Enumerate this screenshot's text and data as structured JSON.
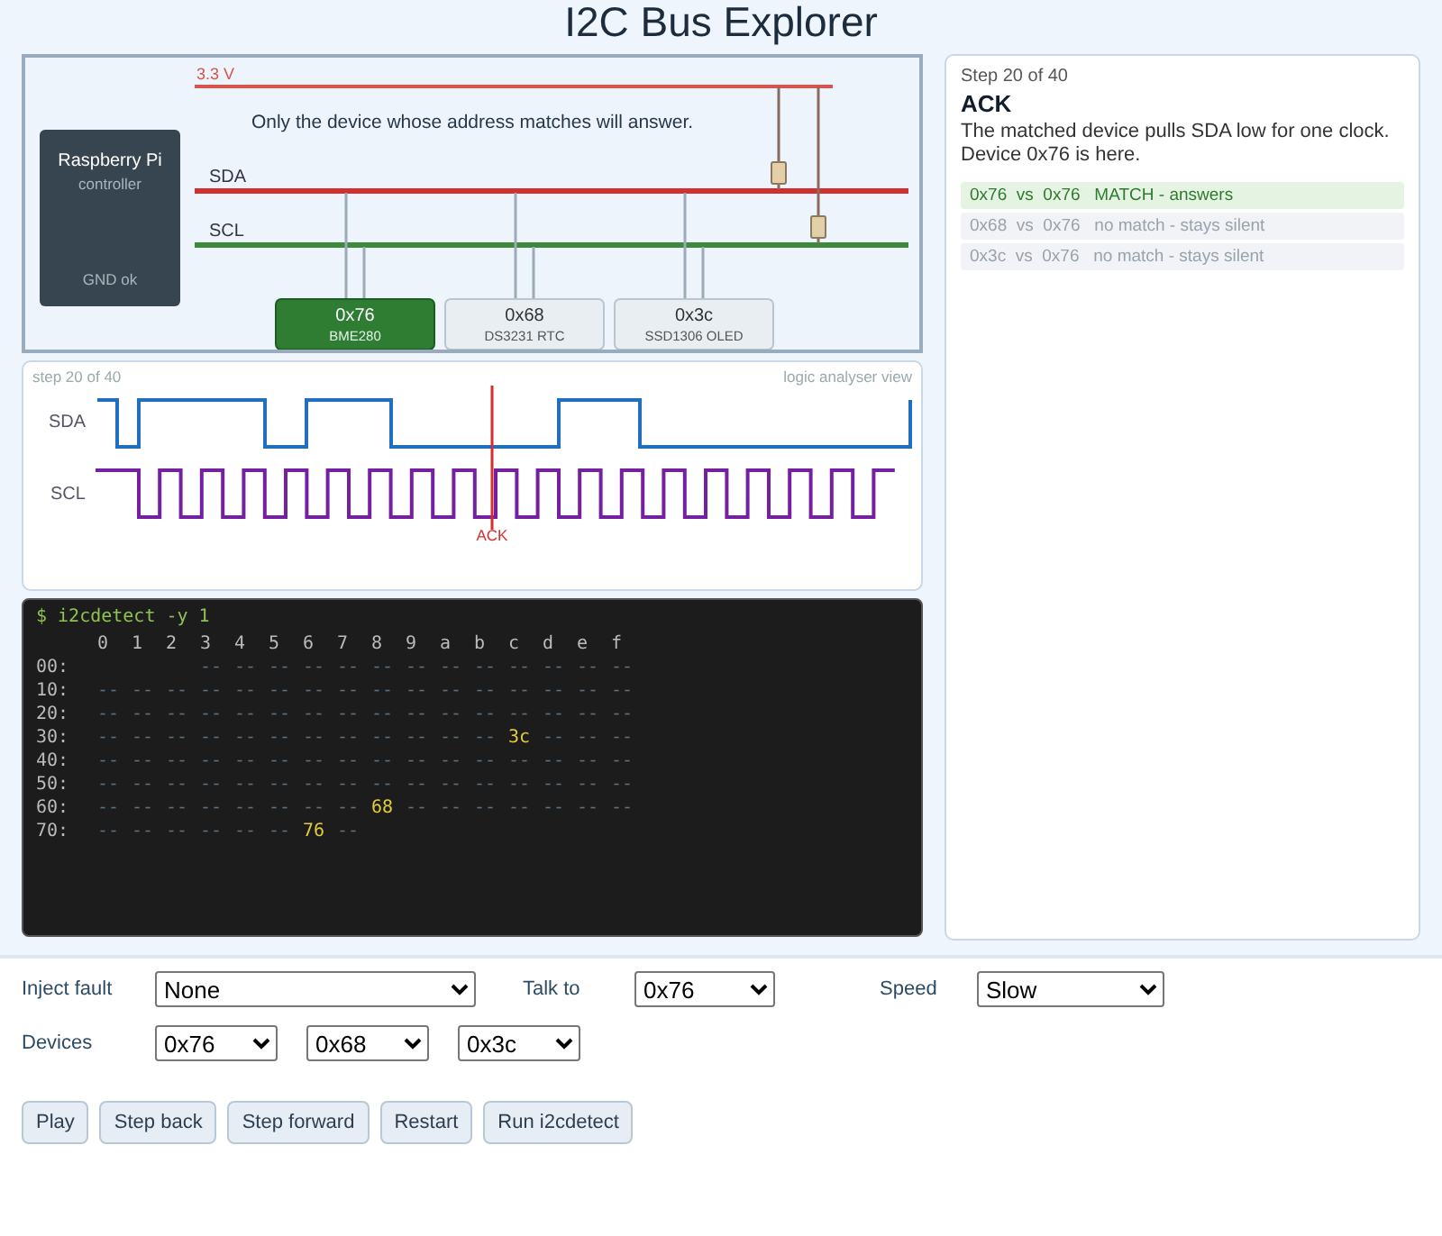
{
  "title": "I2C Bus Explorer",
  "bus": {
    "voltage": "3.3 V",
    "caption": "Only the device whose address matches will answer.",
    "sda": "SDA",
    "scl": "SCL",
    "controller": {
      "name": "Raspberry Pi",
      "role": "controller",
      "status": "GND ok"
    },
    "devices": [
      {
        "address": "0x76",
        "name": "BME280",
        "selected": true
      },
      {
        "address": "0x68",
        "name": "DS3231 RTC",
        "selected": false
      },
      {
        "address": "0x3c",
        "name": "SSD1306 OLED",
        "selected": false
      }
    ]
  },
  "analyser": {
    "step": "step 20 of 40",
    "view": "logic analyser view",
    "sda": "SDA",
    "scl": "SCL",
    "marker": "ACK"
  },
  "terminal": {
    "command": "$ i2cdetect -y 1",
    "columns": [
      "0",
      "1",
      "2",
      "3",
      "4",
      "5",
      "6",
      "7",
      "8",
      "9",
      "a",
      "b",
      "c",
      "d",
      "e",
      "f"
    ],
    "rows": [
      {
        "label": "00:",
        "cells": [
          "",
          "",
          "",
          "--",
          "--",
          "--",
          "--",
          "--",
          "--",
          "--",
          "--",
          "--",
          "--",
          "--",
          "--",
          "--"
        ]
      },
      {
        "label": "10:",
        "cells": [
          "--",
          "--",
          "--",
          "--",
          "--",
          "--",
          "--",
          "--",
          "--",
          "--",
          "--",
          "--",
          "--",
          "--",
          "--",
          "--"
        ]
      },
      {
        "label": "20:",
        "cells": [
          "--",
          "--",
          "--",
          "--",
          "--",
          "--",
          "--",
          "--",
          "--",
          "--",
          "--",
          "--",
          "--",
          "--",
          "--",
          "--"
        ]
      },
      {
        "label": "30:",
        "cells": [
          "--",
          "--",
          "--",
          "--",
          "--",
          "--",
          "--",
          "--",
          "--",
          "--",
          "--",
          "--",
          {
            "text": "3c",
            "found": true
          },
          "--",
          "--",
          "--"
        ]
      },
      {
        "label": "40:",
        "cells": [
          "--",
          "--",
          "--",
          "--",
          "--",
          "--",
          "--",
          "--",
          "--",
          "--",
          "--",
          "--",
          "--",
          "--",
          "--",
          "--"
        ]
      },
      {
        "label": "50:",
        "cells": [
          "--",
          "--",
          "--",
          "--",
          "--",
          "--",
          "--",
          "--",
          "--",
          "--",
          "--",
          "--",
          "--",
          "--",
          "--",
          "--"
        ]
      },
      {
        "label": "60:",
        "cells": [
          "--",
          "--",
          "--",
          "--",
          "--",
          "--",
          "--",
          "--",
          {
            "text": "68",
            "found": true
          },
          "--",
          "--",
          "--",
          "--",
          "--",
          "--",
          "--"
        ]
      },
      {
        "label": "70:",
        "cells": [
          "--",
          "--",
          "--",
          "--",
          "--",
          "--",
          {
            "text": "76",
            "found": true
          },
          "--"
        ]
      }
    ]
  },
  "info": {
    "step": "Step 20 of 40",
    "heading": "ACK",
    "text": "The matched device pulls SDA low for one clock. Device 0x76 is here.",
    "comparisons": [
      {
        "text": "0x76  vs  0x76   MATCH - answers",
        "match": true
      },
      {
        "text": "0x68  vs  0x76   no match - stays silent",
        "match": false
      },
      {
        "text": "0x3c  vs  0x76   no match - stays silent",
        "match": false
      }
    ]
  },
  "controls": {
    "fault": {
      "label": "Inject fault",
      "value": "None"
    },
    "talk": {
      "label": "Talk to",
      "value": "0x76"
    },
    "speed": {
      "label": "Speed",
      "value": "Slow"
    },
    "devices": {
      "label": "Devices",
      "values": [
        "0x76",
        "0x68",
        "0x3c"
      ]
    }
  },
  "buttons": [
    "Play",
    "Step back",
    "Step forward",
    "Restart",
    "Run i2cdetect"
  ]
}
